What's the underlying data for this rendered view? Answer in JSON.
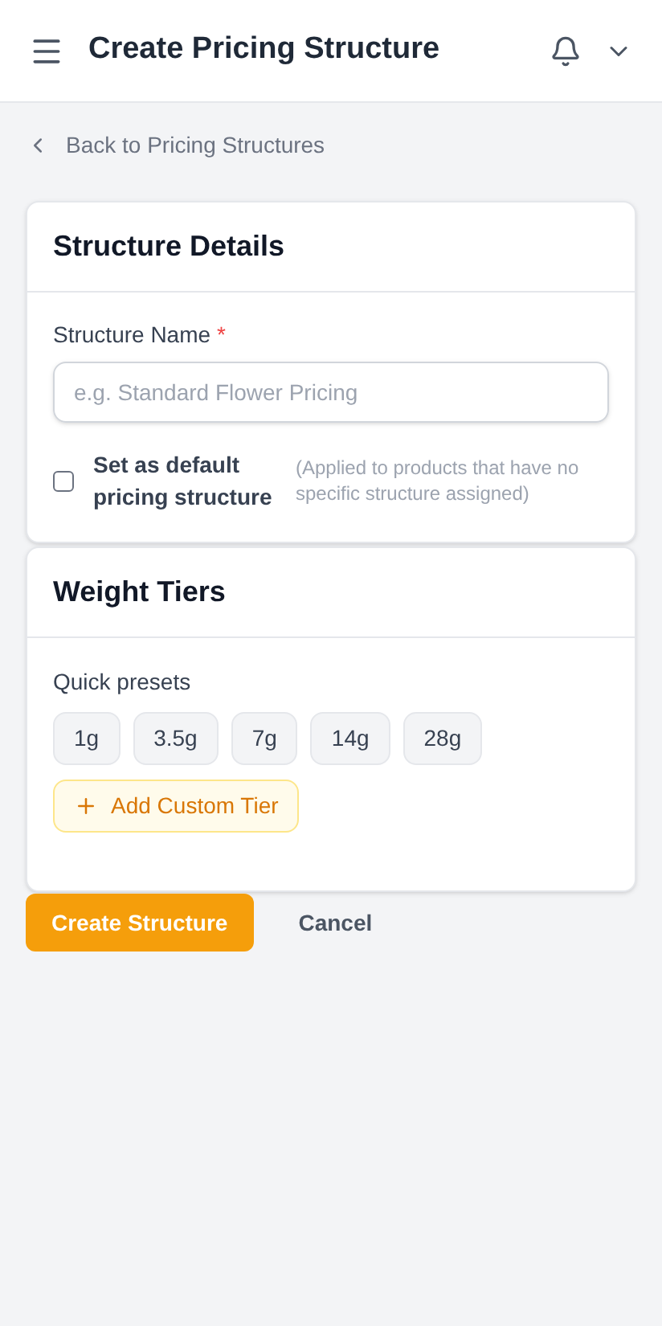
{
  "header": {
    "title": "Create Pricing Structure"
  },
  "back_link": {
    "label": "Back to Pricing Structures"
  },
  "details": {
    "title": "Structure Details",
    "name_field": {
      "label": "Structure Name",
      "required_mark": "*",
      "placeholder": "e.g. Standard Flower Pricing"
    },
    "default_option": {
      "label": "Set as default pricing structure",
      "checked": false,
      "hint": "(Applied to products that have no specific structure assigned)"
    }
  },
  "weight_tiers": {
    "title": "Weight Tiers",
    "presets_label": "Quick presets",
    "presets": [
      "1g",
      "3.5g",
      "7g",
      "14g",
      "28g"
    ],
    "add_button": "Add Custom Tier"
  },
  "actions": {
    "primary": "Create Structure",
    "secondary": "Cancel"
  }
}
